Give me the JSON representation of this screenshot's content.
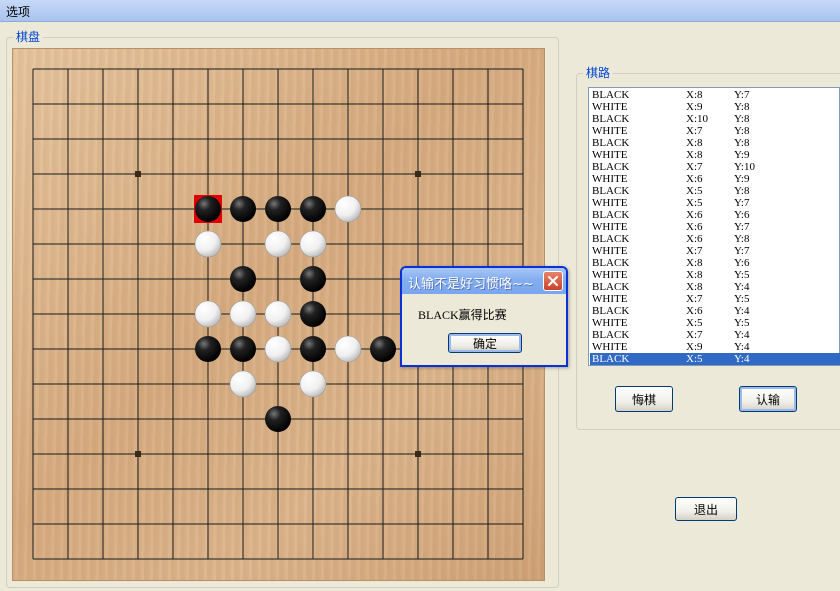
{
  "menu": {
    "options": "选项"
  },
  "board_group": {
    "title": "棋盘"
  },
  "moves_group": {
    "title": "棋路"
  },
  "moves": [
    {
      "color": "BLACK",
      "x": "X:8",
      "y": "Y:7"
    },
    {
      "color": "WHITE",
      "x": "X:9",
      "y": "Y:8"
    },
    {
      "color": "BLACK",
      "x": "X:10",
      "y": "Y:8"
    },
    {
      "color": "WHITE",
      "x": "X:7",
      "y": "Y:8"
    },
    {
      "color": "BLACK",
      "x": "X:8",
      "y": "Y:8"
    },
    {
      "color": "WHITE",
      "x": "X:8",
      "y": "Y:9"
    },
    {
      "color": "BLACK",
      "x": "X:7",
      "y": "Y:10"
    },
    {
      "color": "WHITE",
      "x": "X:6",
      "y": "Y:9"
    },
    {
      "color": "BLACK",
      "x": "X:5",
      "y": "Y:8"
    },
    {
      "color": "WHITE",
      "x": "X:5",
      "y": "Y:7"
    },
    {
      "color": "BLACK",
      "x": "X:6",
      "y": "Y:6"
    },
    {
      "color": "WHITE",
      "x": "X:6",
      "y": "Y:7"
    },
    {
      "color": "BLACK",
      "x": "X:6",
      "y": "Y:8"
    },
    {
      "color": "WHITE",
      "x": "X:7",
      "y": "Y:7"
    },
    {
      "color": "BLACK",
      "x": "X:8",
      "y": "Y:6"
    },
    {
      "color": "WHITE",
      "x": "X:8",
      "y": "Y:5"
    },
    {
      "color": "BLACK",
      "x": "X:8",
      "y": "Y:4"
    },
    {
      "color": "WHITE",
      "x": "X:7",
      "y": "Y:5"
    },
    {
      "color": "BLACK",
      "x": "X:6",
      "y": "Y:4"
    },
    {
      "color": "WHITE",
      "x": "X:5",
      "y": "Y:5"
    },
    {
      "color": "BLACK",
      "x": "X:7",
      "y": "Y:4"
    },
    {
      "color": "WHITE",
      "x": "X:9",
      "y": "Y:4"
    },
    {
      "color": "BLACK",
      "x": "X:5",
      "y": "Y:4",
      "selected": true
    }
  ],
  "buttons": {
    "undo": "悔棋",
    "resign": "认输",
    "exit": "退出"
  },
  "dialog": {
    "title": "认输不是好习惯咯~~",
    "message": "BLACK赢得比赛",
    "ok": "确定"
  },
  "board": {
    "size": 15,
    "last_move_color": "#e00000",
    "black_stones": [
      [
        5,
        4
      ],
      [
        6,
        4
      ],
      [
        7,
        4
      ],
      [
        8,
        4
      ],
      [
        6,
        6
      ],
      [
        8,
        6
      ],
      [
        8,
        7
      ],
      [
        5,
        8
      ],
      [
        6,
        8
      ],
      [
        8,
        8
      ],
      [
        10,
        8
      ],
      [
        7,
        10
      ]
    ],
    "white_stones": [
      [
        9,
        4
      ],
      [
        5,
        5
      ],
      [
        7,
        5
      ],
      [
        8,
        5
      ],
      [
        5,
        7
      ],
      [
        6,
        7
      ],
      [
        7,
        7
      ],
      [
        7,
        8
      ],
      [
        9,
        8
      ],
      [
        6,
        9
      ],
      [
        8,
        9
      ]
    ],
    "last_move": [
      5,
      4
    ]
  }
}
